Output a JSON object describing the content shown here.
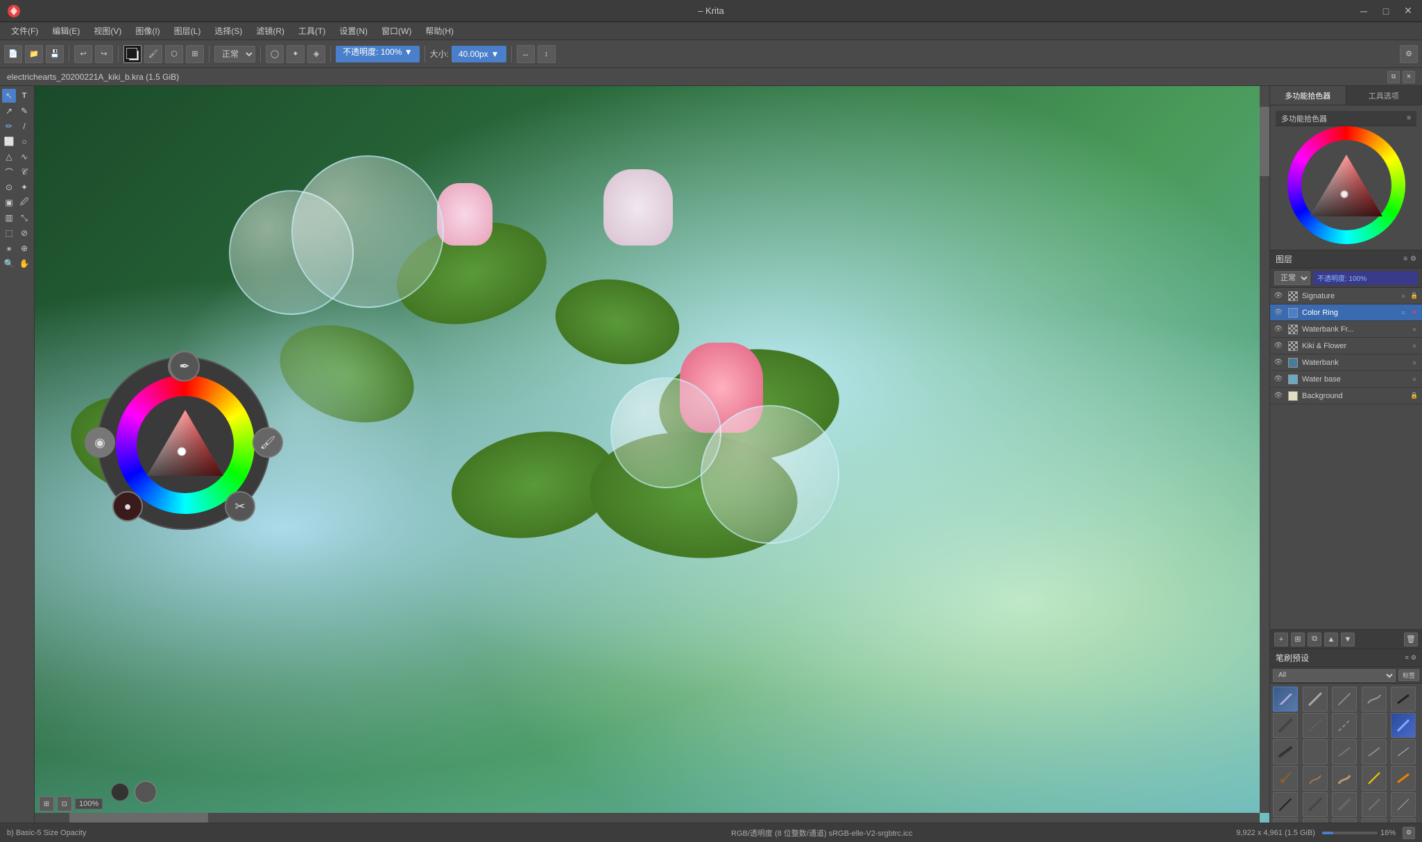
{
  "app": {
    "title": "– Krita",
    "file_name": "electrichearts_20200221A_kiki_b.kra (1.5 GiB)"
  },
  "title_bar": {
    "controls": [
      "─",
      "□",
      "✕"
    ]
  },
  "menu": {
    "items": [
      "文件(F)",
      "编辑(E)",
      "视图(V)",
      "图像(I)",
      "图层(L)",
      "选择(S)",
      "滤镜(R)",
      "工具(T)",
      "设置(N)",
      "窗口(W)",
      "帮助(H)"
    ]
  },
  "toolbar": {
    "blend_mode": "正常",
    "opacity_label": "不透明度:",
    "opacity_value": "100%",
    "size_label": "大小:",
    "size_value": "40.00px"
  },
  "right_panel": {
    "tabs": [
      "多功能拾色器",
      "工具选项"
    ],
    "active_tab": "多功能拾色器",
    "color_panel_label": "多功能拾色器",
    "layers": {
      "header": "图层",
      "blend_mode": "正常",
      "opacity": "不透明度: 100%",
      "items": [
        {
          "name": "Signature",
          "visible": true,
          "active": false,
          "type": "normal"
        },
        {
          "name": "Color Ring",
          "visible": true,
          "active": true,
          "type": "blue"
        },
        {
          "name": "Waterbank Fr...",
          "visible": true,
          "active": false,
          "type": "normal"
        },
        {
          "name": "Kiki & Flower",
          "visible": true,
          "active": false,
          "type": "normal"
        },
        {
          "name": "Waterbank",
          "visible": true,
          "active": false,
          "type": "normal"
        },
        {
          "name": "Water base",
          "visible": true,
          "active": false,
          "type": "normal"
        },
        {
          "name": "Background",
          "visible": true,
          "active": false,
          "type": "locked"
        }
      ]
    },
    "brushes": {
      "header": "笔刷预设",
      "filter": "All",
      "tag_label": "标签"
    }
  },
  "status_bar": {
    "brush_info": "b) Basic-5 Size Opacity",
    "color_info": "RGB/透明度 (8 位整数/通道) sRGB-elle-V2-srgbtrc.icc",
    "dimensions": "9,922 x 4,961 (1.5 GiB)",
    "zoom": "16%"
  },
  "canvas": {
    "view_controls": {
      "zoom_label": "100%"
    }
  },
  "toolbox": {
    "tools": [
      "↖",
      "T",
      "↗",
      "✏",
      "✒",
      "⬜",
      "○",
      "△",
      "∧",
      "~",
      "⌀",
      "✂",
      "⬛",
      "🔍",
      "∥",
      "⤡",
      "⬚",
      "↺",
      "🔎",
      "✋"
    ]
  }
}
